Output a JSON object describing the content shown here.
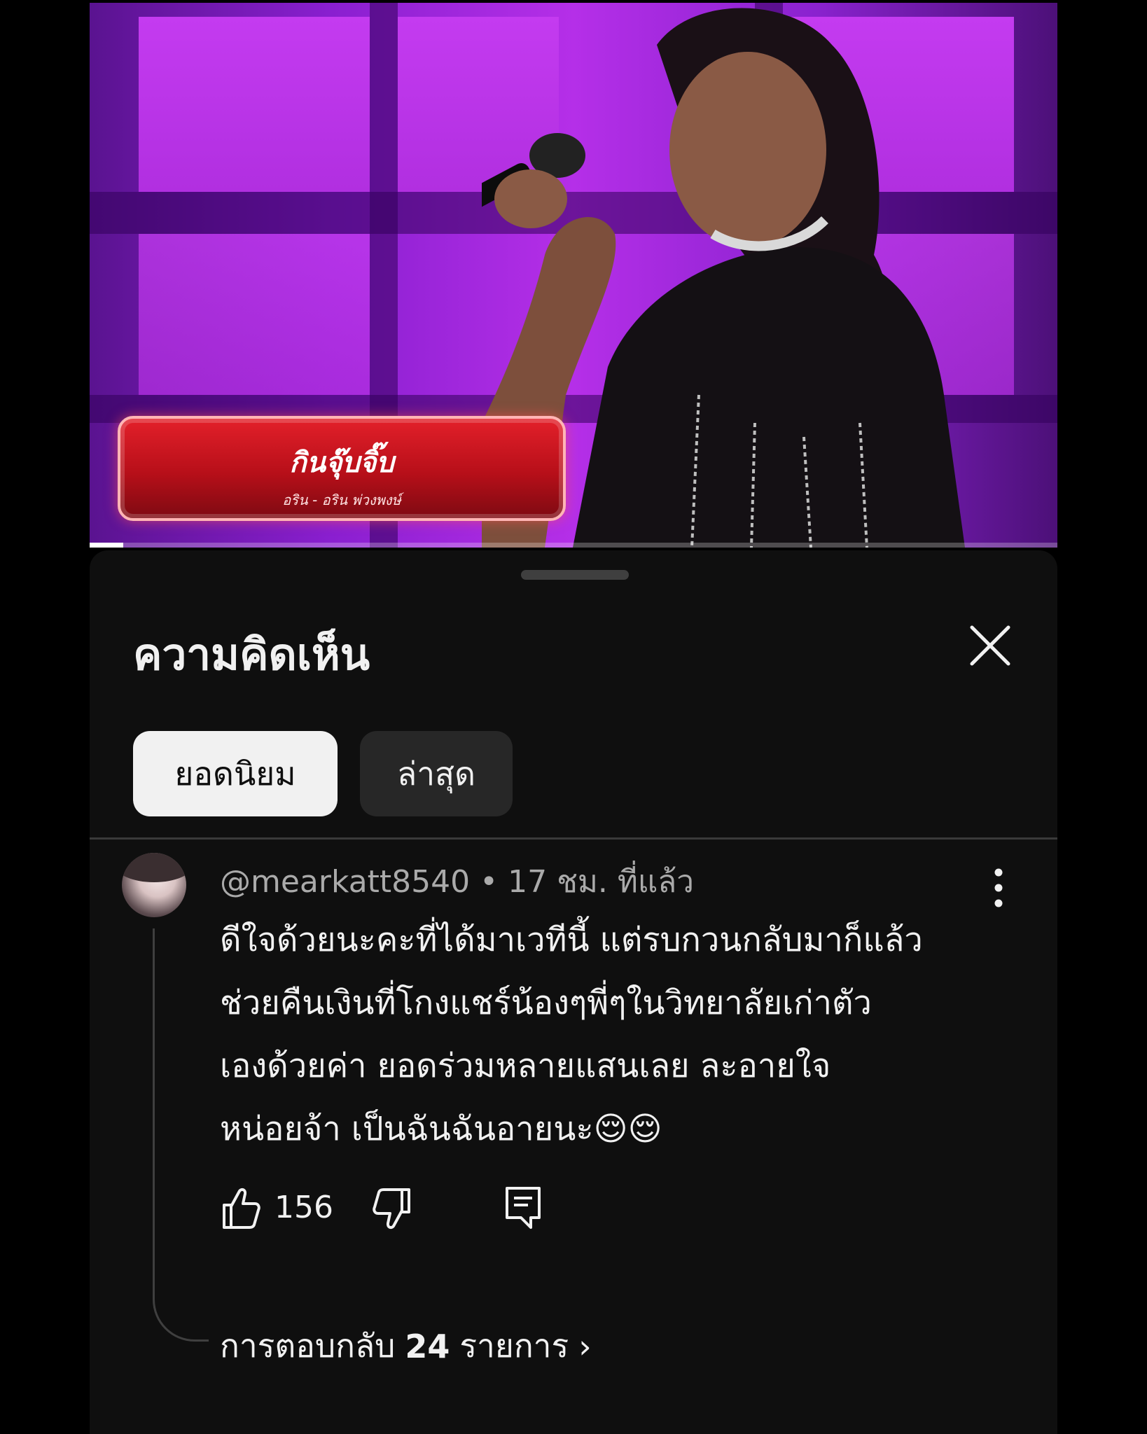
{
  "video": {
    "song_title": "กินจุ๊บจิ๊บ",
    "artist": "อริน - อริน พ่วงพงษ์",
    "progress": 0.035
  },
  "comments_panel": {
    "title": "ความคิดเห็น",
    "close_icon": "close-icon",
    "sort_chips": [
      {
        "label": "ยอดนิยม",
        "selected": true
      },
      {
        "label": "ล่าสุด",
        "selected": false
      }
    ]
  },
  "comment": {
    "author": "@mearkatt8540",
    "separator": "•",
    "time": "17 ชม. ที่แล้ว",
    "lines": [
      "ดีใจด้วยนะคะที่ได้มาเวทีนี้ แต่รบกวนกลับมาก็แล้ว",
      "ช่วยคืนเงินที่โกงแชร์น้องๆพี่ๆในวิทยาลัยเก่าตัว",
      "เองด้วยค่า ยอดร่วมหลายแสนเลย ละอายใจ",
      "หน่อยจ้า เป็นฉันฉันอายนะ😌😌"
    ],
    "likes": "156",
    "replies_prefix": "การตอบกลับ",
    "replies_count": "24",
    "replies_suffix": "รายการ",
    "replies_chevron": "›"
  },
  "colors": {
    "sheet_bg": "#0f0f0f",
    "text_primary": "#f1f1f1",
    "text_secondary": "#aaaaaa",
    "chip_active_bg": "#f1f1f1",
    "chip_inactive_bg": "#272727",
    "plate_red": "#d0121c"
  }
}
